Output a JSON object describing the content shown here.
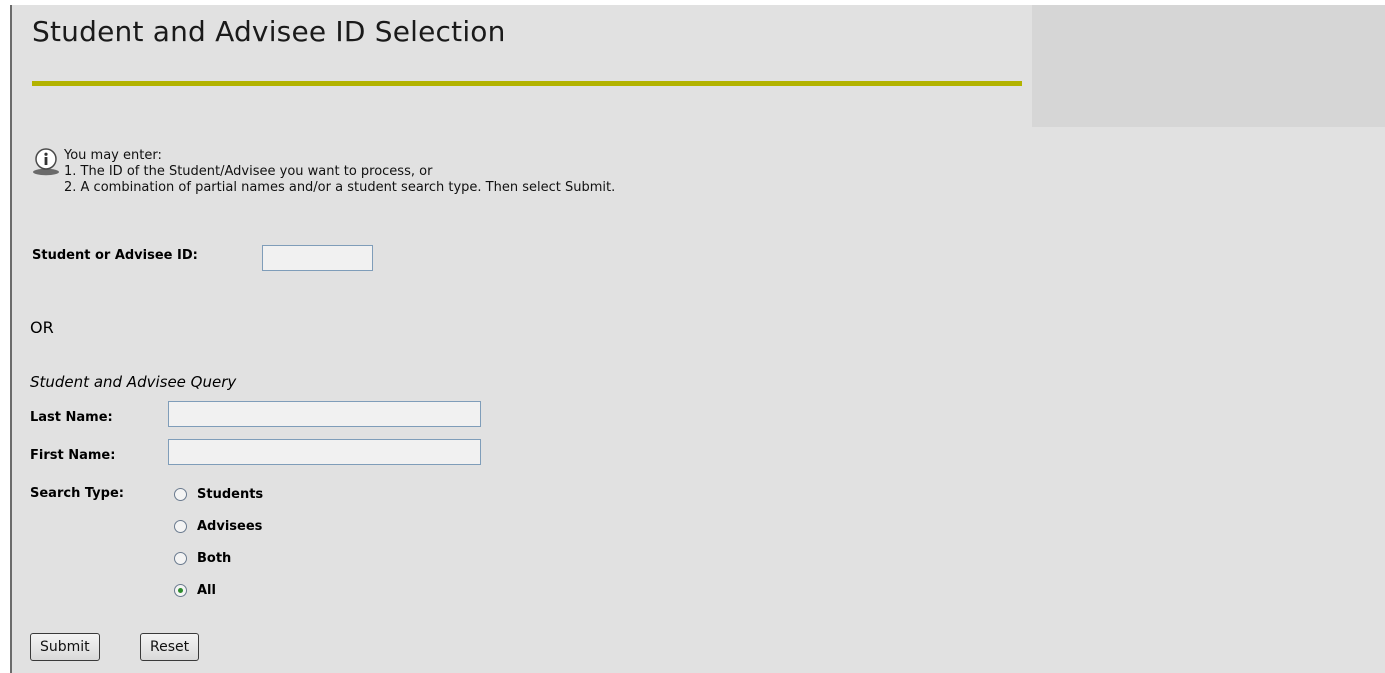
{
  "header": {
    "title": "Student and Advisee ID Selection"
  },
  "info": {
    "icon": "info-icon",
    "lines": [
      "You may enter:",
      "1. The ID of the Student/Advisee you want to process, or",
      "2. A combination of partial names and/or a student search type. Then select Submit."
    ]
  },
  "id_field": {
    "label": "Student or Advisee ID:",
    "value": ""
  },
  "or_label": "OR",
  "query": {
    "title": "Student and Advisee Query",
    "last_name_label": "Last Name:",
    "last_name_value": "",
    "first_name_label": "First Name:",
    "first_name_value": "",
    "search_type_label": "Search Type:",
    "options": [
      {
        "label": "Students",
        "checked": false
      },
      {
        "label": "Advisees",
        "checked": false
      },
      {
        "label": "Both",
        "checked": false
      },
      {
        "label": "All",
        "checked": true
      }
    ]
  },
  "buttons": {
    "submit": "Submit",
    "reset": "Reset"
  },
  "colors": {
    "accent_rule": "#b3b300",
    "page_bg": "#e1e1e1"
  }
}
